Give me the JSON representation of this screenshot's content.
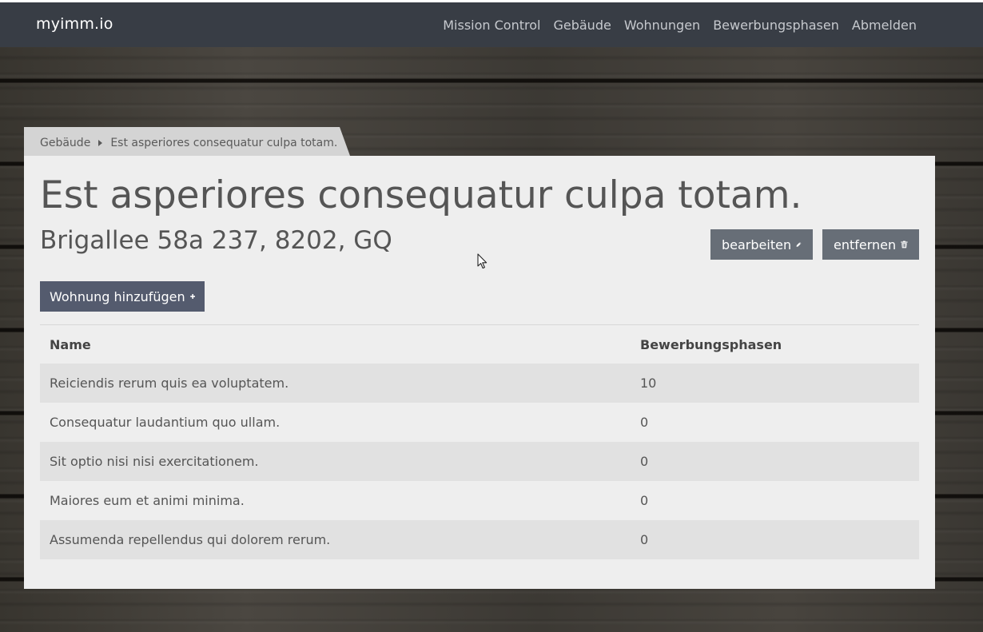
{
  "navbar": {
    "brand": "myimm.io",
    "links": [
      {
        "label": "Mission Control"
      },
      {
        "label": "Gebäude"
      },
      {
        "label": "Wohnungen"
      },
      {
        "label": "Bewerbungsphasen"
      },
      {
        "label": "Abmelden"
      }
    ]
  },
  "breadcrumb": {
    "items": [
      "Gebäude",
      "Est asperiores consequatur culpa totam."
    ]
  },
  "building": {
    "title": "Est asperiores consequatur culpa totam.",
    "address": "Brigallee 58a 237, 8202, GQ"
  },
  "actions": {
    "edit_label": "bearbeiten",
    "delete_label": "entfernen",
    "add_label": "Wohnung hinzufügen"
  },
  "table": {
    "headers": [
      "Name",
      "Bewerbungsphasen"
    ],
    "rows": [
      [
        "Reiciendis rerum quis ea voluptatem.",
        "10"
      ],
      [
        "Consequatur laudantium quo ullam.",
        "0"
      ],
      [
        "Sit optio nisi nisi exercitationem.",
        "0"
      ],
      [
        "Maiores eum et animi minima.",
        "0"
      ],
      [
        "Assumenda repellendus qui dolorem rerum.",
        "0"
      ]
    ]
  },
  "icons": {
    "edit": "pencil-icon",
    "delete": "trash-icon",
    "add": "plus-icon",
    "breadcrumb_separator": "caret-right-icon"
  },
  "colors": {
    "navbar": "#383d45",
    "card": "#eeeeee",
    "button": "#676e77",
    "primary_button": "#545b6e"
  }
}
